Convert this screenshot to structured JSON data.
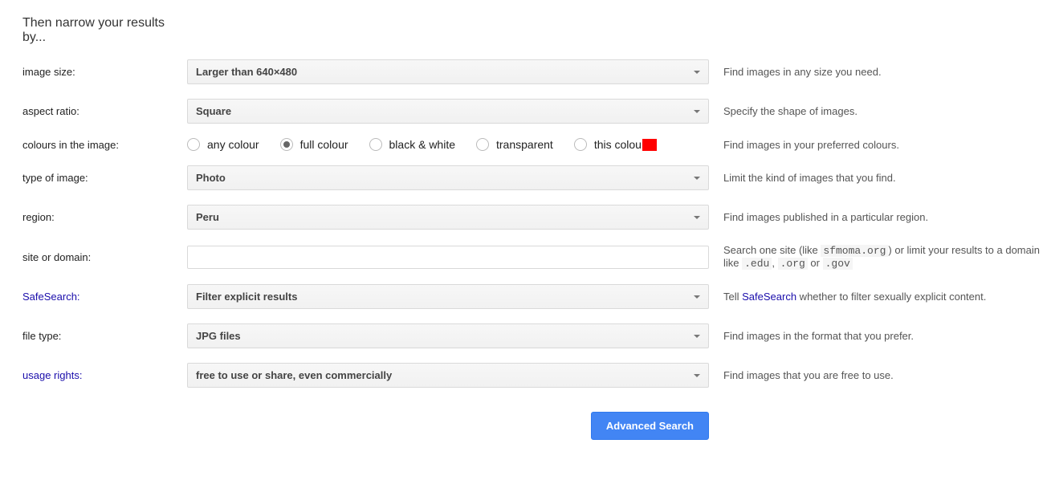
{
  "heading": "Then narrow your results by...",
  "rows": {
    "imageSize": {
      "label": "image size:",
      "value": "Larger than 640×480",
      "help": "Find images in any size you need."
    },
    "aspectRatio": {
      "label": "aspect ratio:",
      "value": "Square",
      "help": "Specify the shape of images."
    },
    "colours": {
      "label": "colours in the image:",
      "options": {
        "any": "any colour",
        "full": "full colour",
        "bw": "black & white",
        "transparent": "transparent",
        "this": "this colour"
      },
      "selected": "full",
      "swatch": "#ff0000",
      "help": "Find images in your preferred colours."
    },
    "typeOfImage": {
      "label": "type of image:",
      "value": "Photo",
      "help": "Limit the kind of images that you find."
    },
    "region": {
      "label": "region:",
      "value": "Peru",
      "help": "Find images published in a particular region."
    },
    "siteOrDomain": {
      "label": "site or domain:",
      "value": "",
      "help_pre": "Search one site (like ",
      "help_code1": "sfmoma.org",
      "help_mid": ") or limit your results to a domain like ",
      "help_code2": ".edu",
      "help_sep": ", ",
      "help_code3": ".org",
      "help_or": " or ",
      "help_code4": ".gov"
    },
    "safeSearch": {
      "label": "SafeSearch:",
      "value": "Filter explicit results",
      "help_pre": "Tell ",
      "help_link": "SafeSearch",
      "help_post": " whether to filter sexually explicit content."
    },
    "fileType": {
      "label": "file type:",
      "value": "JPG files",
      "help": "Find images in the format that you prefer."
    },
    "usageRights": {
      "label": "usage rights:",
      "value": "free to use or share, even commercially",
      "help": "Find images that you are free to use."
    }
  },
  "submit": "Advanced Search"
}
